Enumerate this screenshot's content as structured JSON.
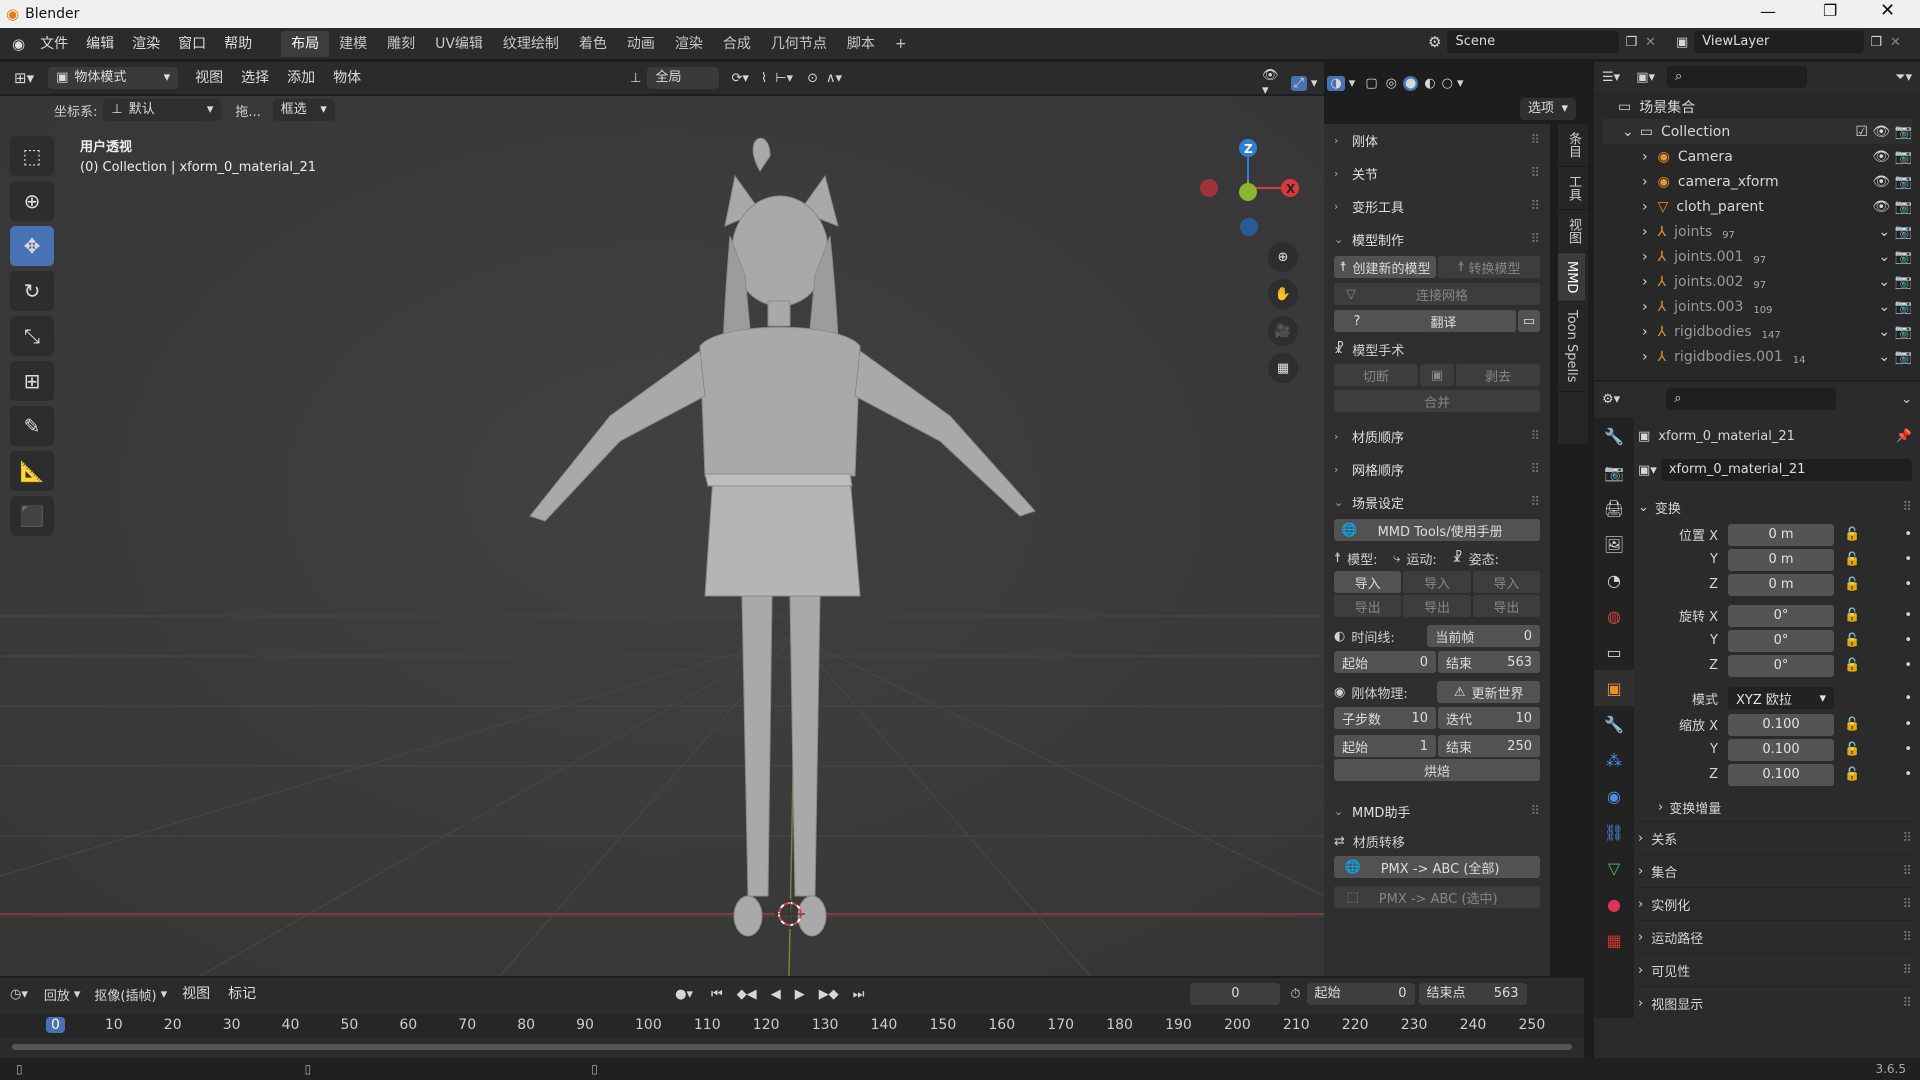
{
  "window": {
    "title": "Blender",
    "version": "3.6.5"
  },
  "menus": [
    "文件",
    "编辑",
    "渲染",
    "窗口",
    "帮助"
  ],
  "workspaces": [
    "布局",
    "建模",
    "雕刻",
    "UV编辑",
    "纹理绘制",
    "着色",
    "动画",
    "渲染",
    "合成",
    "几何节点",
    "脚本"
  ],
  "scene": {
    "name": "Scene",
    "viewlayer": "ViewLayer"
  },
  "viewport": {
    "mode": "物体模式",
    "menus": [
      "视图",
      "选择",
      "添加",
      "物体"
    ],
    "orientation": "全局",
    "coord_label": "坐标系:",
    "coord_value": "默认",
    "drag_label": "拖...",
    "select_mode": "框选",
    "options": "选项",
    "overlay_title": "用户透视",
    "overlay_sub": "(0) Collection | xform_0_material_21"
  },
  "npanel": {
    "tabs": [
      "条目",
      "工具",
      "视图",
      "MMD",
      "Toon Spells"
    ],
    "rigid": "刚体",
    "joint": "关节",
    "deform": "变形工具",
    "model_make": "模型制作",
    "create_model": "创建新的模型",
    "convert_model": "转换模型",
    "join_mesh": "连接网格",
    "translate": "翻译",
    "surgery": "模型手术",
    "cut": "切断",
    "separate": "剥去",
    "merge": "合并",
    "material_order": "材质顺序",
    "mesh_order": "网格顺序",
    "scene_setup": "场景设定",
    "manual": "MMD Tools/使用手册",
    "model": "模型:",
    "motion": "运动:",
    "pose": "姿态:",
    "import": "导入",
    "export": "导出",
    "timeline": "时间线:",
    "current_frame": "当前帧",
    "current_value": "0",
    "start": "起始",
    "start_value": "0",
    "end": "结束",
    "end_value": "563",
    "rigid_physics": "刚体物理:",
    "update_world": "更新世界",
    "substeps": "子步数",
    "substeps_value": "10",
    "iterations": "迭代",
    "iterations_value": "10",
    "phys_start_value": "1",
    "phys_end_value": "250",
    "bake": "烘焙",
    "mmd_helper": "MMD助手",
    "material_transfer": "材质转移",
    "pmx_all": "PMX -> ABC (全部)",
    "pmx_sel": "PMX -> ABC (选中)"
  },
  "outliner": {
    "root": "场景集合",
    "collection": "Collection",
    "items": [
      {
        "name": "Camera",
        "badge": ""
      },
      {
        "name": "camera_xform",
        "badge": ""
      },
      {
        "name": "cloth_parent",
        "badge": ""
      },
      {
        "name": "joints",
        "badge": "97"
      },
      {
        "name": "joints.001",
        "badge": "97"
      },
      {
        "name": "joints.002",
        "badge": "97"
      },
      {
        "name": "joints.003",
        "badge": "109"
      },
      {
        "name": "rigidbodies",
        "badge": "147"
      },
      {
        "name": "rigidbodies.001",
        "badge": "14"
      }
    ]
  },
  "properties": {
    "object": "xform_0_material_21",
    "datablock": "xform_0_material_21",
    "transform": "变换",
    "loc": "位置 X",
    "rot": "旋转 X",
    "scale": "缩放 X",
    "y": "Y",
    "z": "Z",
    "loc_vals": [
      "0 m",
      "0 m",
      "0 m"
    ],
    "rot_vals": [
      "0°",
      "0°",
      "0°"
    ],
    "scale_vals": [
      "0.100",
      "0.100",
      "0.100"
    ],
    "mode_label": "模式",
    "mode_value": "XYZ 欧拉",
    "delta": "变换增量",
    "sections": [
      "关系",
      "集合",
      "实例化",
      "运动路径",
      "可见性",
      "视图显示"
    ]
  },
  "timeline": {
    "playback": "回放",
    "keying": "抠像(插帧)",
    "view": "视图",
    "marker": "标记",
    "frame": "0",
    "start_label": "起始",
    "start": "0",
    "end_label": "结束点",
    "end": "563",
    "ticks": [
      "0",
      "10",
      "20",
      "30",
      "40",
      "50",
      "60",
      "70",
      "80",
      "90",
      "100",
      "110",
      "120",
      "130",
      "140",
      "150",
      "160",
      "170",
      "180",
      "190",
      "200",
      "210",
      "220",
      "230",
      "240",
      "250"
    ]
  },
  "colors": {
    "accent": "#4772b3",
    "x_axis": "#d9383e",
    "y_axis": "#8ab632",
    "z_axis": "#2f7fd6"
  }
}
